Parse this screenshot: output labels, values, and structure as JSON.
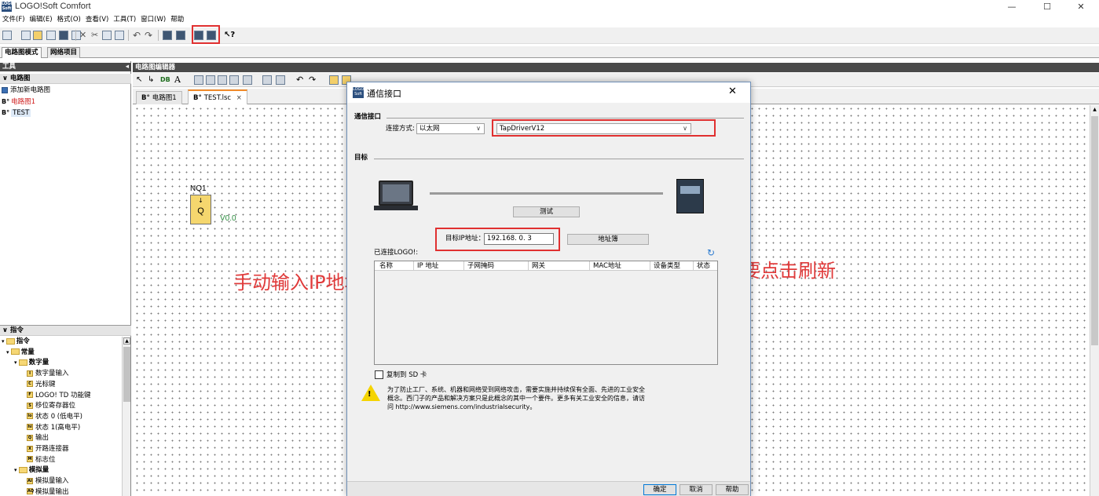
{
  "window": {
    "title": "LOGO!Soft Comfort",
    "logo_text": "LOGO Soft",
    "minimize_glyph": "—",
    "maximize_glyph": "☐",
    "close_glyph": "✕"
  },
  "menu": [
    "文件(F)",
    "编辑(E)",
    "格式(O)",
    "查看(V)",
    "工具(T)",
    "窗口(W)",
    "帮助"
  ],
  "mode_tabs": [
    "电路图模式",
    "网络项目"
  ],
  "left_panel": {
    "header": "工具",
    "circuit_section": "电路图",
    "circuit_items": [
      "添加新电路图",
      "电路图1",
      "TEST"
    ],
    "instr_section": "指令",
    "tree": [
      {
        "label": "指令",
        "level": 0,
        "kind": "folder"
      },
      {
        "label": "常量",
        "level": 1,
        "kind": "folder"
      },
      {
        "label": "数字量",
        "level": 2,
        "kind": "folder"
      },
      {
        "label": "数字量输入",
        "level": 3,
        "kind": "block",
        "tag": "I"
      },
      {
        "label": "光标键",
        "level": 3,
        "kind": "block",
        "tag": "C"
      },
      {
        "label": "LOGO! TD 功能键",
        "level": 3,
        "kind": "block",
        "tag": "F"
      },
      {
        "label": "移位寄存器位",
        "level": 3,
        "kind": "block",
        "tag": "S"
      },
      {
        "label": "状态 0 (低电平)",
        "level": 3,
        "kind": "block",
        "tag": "lo"
      },
      {
        "label": "状态 1(高电平)",
        "level": 3,
        "kind": "block",
        "tag": "hi"
      },
      {
        "label": "输出",
        "level": 3,
        "kind": "block",
        "tag": "Q"
      },
      {
        "label": "开路连接器",
        "level": 3,
        "kind": "block",
        "tag": "X"
      },
      {
        "label": "标志位",
        "level": 3,
        "kind": "block",
        "tag": "M"
      },
      {
        "label": "模拟量",
        "level": 2,
        "kind": "folder"
      },
      {
        "label": "模拟量输入",
        "level": 3,
        "kind": "block",
        "tag": "AI"
      },
      {
        "label": "模拟量输出",
        "level": 3,
        "kind": "block",
        "tag": "AQ"
      }
    ]
  },
  "editor": {
    "header": "电路图编辑器",
    "tabs": [
      "电路图1",
      "TEST.lsc"
    ],
    "tab_close": "×",
    "block": {
      "name": "NQ1",
      "letter": "Q",
      "value": "V0.0"
    }
  },
  "dialog": {
    "title": "通信接口",
    "close_glyph": "✕",
    "section_interface": "通信接口",
    "connection_label": "连接方式:",
    "connection_value": "以太网",
    "driver_value": "TapDriverV12",
    "section_target": "目标",
    "test_button": "测试",
    "ip_label": "目标IP地址：",
    "ip_value": "192.168.  0.  3",
    "address_book_button": "地址簿",
    "connected_label": "已连接LOGO!:",
    "columns": [
      "名称",
      "IP 地址",
      "子网掩码",
      "网关",
      "MAC地址",
      "设备类型",
      "状态"
    ],
    "copy_sd_label": "复制到 SD 卡",
    "warning_text": "为了防止工厂、系统、机器和网络受到网络攻击，需要实施并持续保有全面、先进的工业安全概念。西门子的产品和解决方案只是此概念的其中一个要件。更多有关工业安全的信息，请访问 http://www.siemens.com/industrialsecurity。",
    "ok_button": "确定",
    "cancel_button": "取消",
    "help_button": "帮助"
  },
  "annotations": {
    "left": "手动输入IP地址，直接点击测试即可",
    "right": "不要点击刷新"
  },
  "colors": {
    "annotation": "#e03a3a",
    "panel_header": "#4a4a4a",
    "selection": "#dde9f7",
    "ok_button_border": "#0078d7"
  }
}
